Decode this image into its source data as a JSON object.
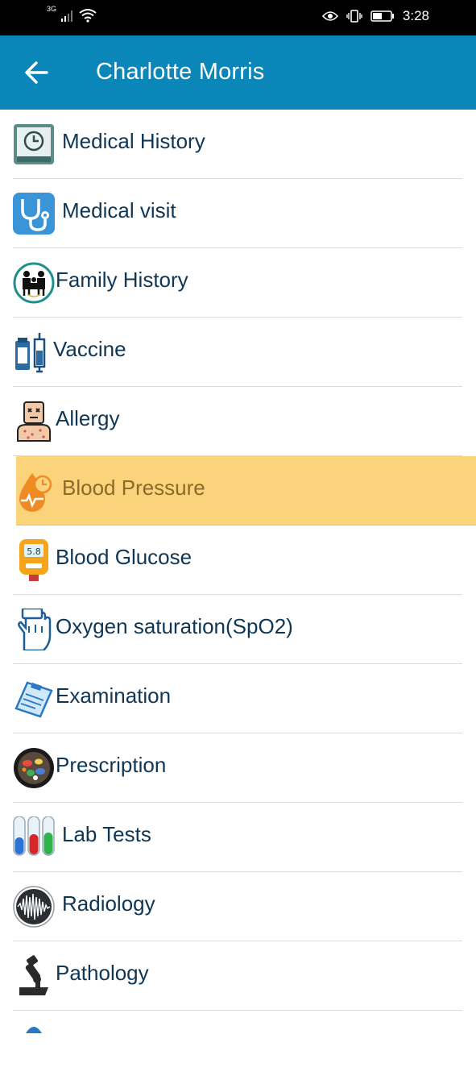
{
  "status_bar": {
    "network": "3G",
    "time": "3:28",
    "icons": [
      "signal-icon",
      "wifi-icon",
      "eye-icon",
      "vibrate-icon",
      "battery-icon"
    ]
  },
  "app_bar": {
    "back_icon": "arrow-left-icon",
    "title": "Charlotte Morris",
    "color": "#0a86b8"
  },
  "menu": {
    "items": [
      {
        "label": "Medical History",
        "icon": "clock-monitor-icon"
      },
      {
        "label": "Medical visit",
        "icon": "stethoscope-icon"
      },
      {
        "label": "Family History",
        "icon": "family-icon"
      },
      {
        "label": "Vaccine",
        "icon": "vaccine-icon"
      },
      {
        "label": "Allergy",
        "icon": "allergy-icon"
      },
      {
        "label": "Blood Pressure",
        "icon": "blood-pressure-icon",
        "selected": true
      },
      {
        "label": "Blood Glucose",
        "icon": "glucose-meter-icon",
        "meter_value": "5.8"
      },
      {
        "label": "Oxygen saturation(SpO2)",
        "icon": "oximeter-hand-icon"
      },
      {
        "label": "Examination",
        "icon": "clipboard-icon"
      },
      {
        "label": "Prescription",
        "icon": "pills-icon"
      },
      {
        "label": "Lab Tests",
        "icon": "test-tubes-icon"
      },
      {
        "label": "Radiology",
        "icon": "waveform-icon"
      },
      {
        "label": "Pathology",
        "icon": "microscope-icon"
      }
    ],
    "selected_color": "#fad37a"
  }
}
